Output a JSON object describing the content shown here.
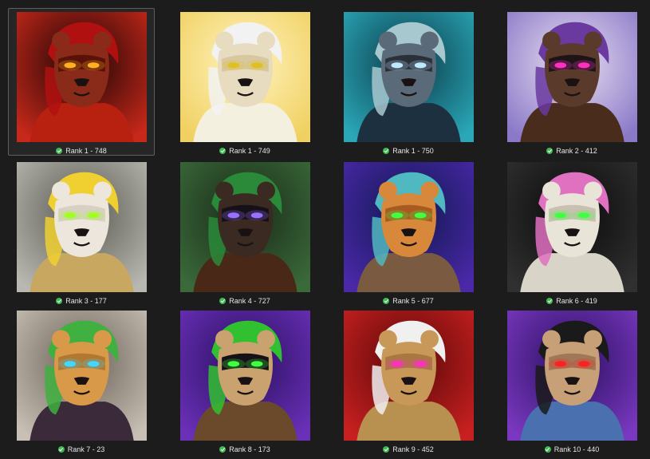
{
  "gallery": {
    "items": [
      {
        "label": "Rank 1 - 748",
        "bg": "#c8281a",
        "bg2": "#1a0505",
        "fur": "#8a2a18",
        "hair": "#b01010",
        "mask": "#5a1208",
        "eyes": "#ffb020",
        "outfit": "#b82010",
        "icon": "red-winged-lion-portrait-icon"
      },
      {
        "label": "Rank 1 - 749",
        "bg": "#f0d060",
        "bg2": "#fff4c0",
        "fur": "#e8dcc0",
        "hair": "#f2f2f2",
        "mask": "#d8c8a0",
        "eyes": "#e0c020",
        "outfit": "#f4f0e0",
        "icon": "golden-lioness-portrait-icon"
      },
      {
        "label": "Rank 1 - 750",
        "bg": "#2aa8b8",
        "bg2": "#0c3a48",
        "fur": "#5a6a78",
        "hair": "#a8c8d0",
        "mask": "#2a2f38",
        "eyes": "#c0e8ff",
        "outfit": "#1c3040",
        "icon": "teal-lioness-portrait-icon"
      },
      {
        "label": "Rank 2 - 412",
        "bg": "#8a78c8",
        "bg2": "#e8e0f0",
        "fur": "#5a3a2a",
        "hair": "#6a3aa0",
        "mask": "#1e1418",
        "eyes": "#ff30c0",
        "outfit": "#4a2c1c",
        "icon": "purple-lioness-portrait-icon"
      },
      {
        "label": "Rank 3 - 177",
        "bg": "#b8b8b0",
        "bg2": "#5a5a52",
        "fur": "#ece6dc",
        "hair": "#f0d030",
        "mask": "#d8d0c4",
        "eyes": "#a0ff20",
        "outfit": "#c8a860",
        "icon": "blonde-lioness-portrait-icon"
      },
      {
        "label": "Rank 4 - 727",
        "bg": "#3a6a3a",
        "bg2": "#1a2a18",
        "fur": "#3a2a22",
        "hair": "#2a8a3a",
        "mask": "#161018",
        "eyes": "#9a70ff",
        "outfit": "#4a2818",
        "icon": "archer-lioness-portrait-icon"
      },
      {
        "label": "Rank 5 - 677",
        "bg": "#4a28a8",
        "bg2": "#101850",
        "fur": "#d8883a",
        "hair": "#50b8c0",
        "mask": "#a85a20",
        "eyes": "#40ff40",
        "outfit": "#7a5a40",
        "icon": "tiger-lioness-portrait-icon"
      },
      {
        "label": "Rank 6 - 419",
        "bg": "#303030",
        "bg2": "#0a0a0a",
        "fur": "#e8e4d8",
        "hair": "#e070c0",
        "mask": "#c8c0b0",
        "eyes": "#40ff40",
        "outfit": "#d8d4c8",
        "icon": "leopard-lioness-portrait-icon"
      },
      {
        "label": "Rank 7 - 23",
        "bg": "#c8c0b4",
        "bg2": "#6a6058",
        "fur": "#d89a48",
        "hair": "#40b040",
        "mask": "#b07830",
        "eyes": "#40d8ff",
        "outfit": "#3a2a3a",
        "icon": "pirate-tiger-portrait-icon"
      },
      {
        "label": "Rank 8 - 173",
        "bg": "#6a30b8",
        "bg2": "#2a1060",
        "fur": "#caa270",
        "hair": "#30c030",
        "mask": "#161018",
        "eyes": "#40ff40",
        "outfit": "#6a4a2a",
        "icon": "green-hair-lioness-portrait-icon"
      },
      {
        "label": "Rank 9 - 452",
        "bg": "#c82020",
        "bg2": "#5a0808",
        "fur": "#c89858",
        "hair": "#f0f0f0",
        "mask": "#a87840",
        "eyes": "#ff30c0",
        "outfit": "#b89050",
        "icon": "white-hair-lioness-portrait-icon"
      },
      {
        "label": "Rank 10 - 440",
        "bg": "#7a38c0",
        "bg2": "#2a1060",
        "fur": "#c8a078",
        "hair": "#1a1a1a",
        "mask": "#a07858",
        "eyes": "#ff2020",
        "outfit": "#4a70b0",
        "icon": "black-hair-lioness-portrait-icon"
      }
    ]
  }
}
